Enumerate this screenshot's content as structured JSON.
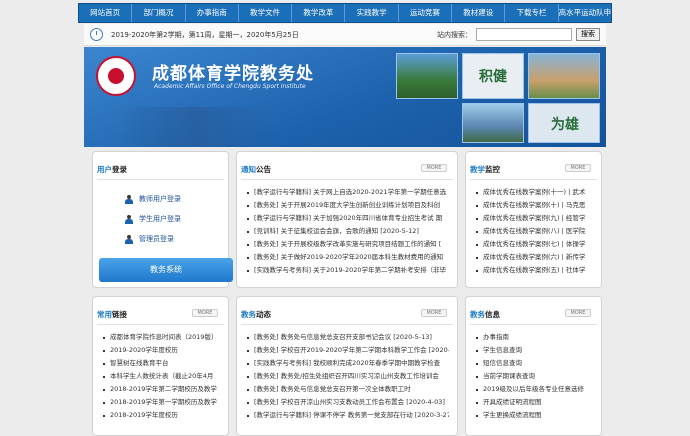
{
  "nav": {
    "items": [
      "网站首页",
      "部门概况",
      "办事指南",
      "教学文件",
      "教学改革",
      "实践教学",
      "运动竞赛",
      "教材建设",
      "下载专栏",
      "高水平运动队申报"
    ]
  },
  "datebar": {
    "date_text": "2019-2020年第2学期，第11周，星期一，2020年5月25日",
    "search_label": "站内搜索：",
    "search_value": "",
    "search_button": "搜索"
  },
  "banner": {
    "title": "成都体育学院教务处",
    "subtitle": "Academic Affairs Office of Chengdu Sport Institute",
    "callig1": "积健",
    "callig2": "为雄"
  },
  "more_label": "MORE",
  "login": {
    "title_a": "用户",
    "title_b": "登录",
    "teacher": "教师用户登录",
    "student": "学生用户登录",
    "admin": "管理员登录",
    "system_button": "教务系统"
  },
  "notice": {
    "title_a": "通知",
    "title_b": "公告",
    "items": [
      "[教学运行与学籍科] 关于网上自选2020-2021学年第一学期任意选",
      "[教务处] 关于开展2019年度大学生创新创业训练计划项目及科创",
      "[教学运行与学籍科] 关于加强2020年四川省体育专业招生考试 期",
      "[竞训科] 关于征集校运会会旗，会歌的通知 [2020-5-12]",
      "[教务处] 关于开展校级教学改革实施与研究项目结题工作的通知 [",
      "[教务处] 关于做好2019-2020学年2020届本科生教材费用的通知",
      "[实践教学与考务科] 关于2019-2020学年第二学期补考安排（非毕"
    ]
  },
  "monitor": {
    "title_a": "教学",
    "title_b": "监控",
    "items": [
      "成体优秀在线教学案例(十一) | 武术",
      "成体优秀在线教学案例(十) | 马克思",
      "成体优秀在线教学案例(九) | 经管学",
      "成体优秀在线教学案例(八) | 医学院",
      "成体优秀在线教学案例(七) | 体操学",
      "成体优秀在线教学案例(六) | 新传学",
      "成体优秀在线教学案例(五) | 社体学"
    ]
  },
  "links": {
    "title_a": "常用",
    "title_b": "链接",
    "items": [
      "成都体育学院作息时间表（2019版）",
      "2019-2020学年度校历",
      "智慧树在线教育平台",
      "本科学生人数统计表（截止20年4月",
      "2018-2019学年第二学期校历及教学",
      "2018-2019学年第一学期校历及教学",
      "2018-2019学年度校历"
    ]
  },
  "teaching_news": {
    "title_a": "教务",
    "title_b": "动态",
    "items": [
      "[教务处] 教务处与信息党总支召开支部书记会议 [2020-5-13]",
      "[教务处] 学校召开2019-2020学年第二学期本科教学工作会 [2020-",
      "[实践教学与考务科] 我校顺利完成2020年春季学期中期教学检查",
      "[教务处] 教务处/招生处组织召开四川实习凉山州支教工作培训会",
      "[教务处] 教务处与信息党总支召开第一次全体教职工时",
      "[教务处] 学校召开凉山州实习支教动员工作会布置会 [2020-4-03]",
      "[教学运行与学籍科] 停课不停学 教务第一党支部在行动 [2020-3-27]"
    ]
  },
  "teaching_info": {
    "title_a": "教务",
    "title_b": "信息",
    "items": [
      "办事指南",
      "学生信息查询",
      "短信信息查询",
      "当前学期课表查询",
      "2019级及以后年级各专业任意选修",
      "开具成绩证明流程图",
      "学生更换成绩流程图"
    ]
  }
}
